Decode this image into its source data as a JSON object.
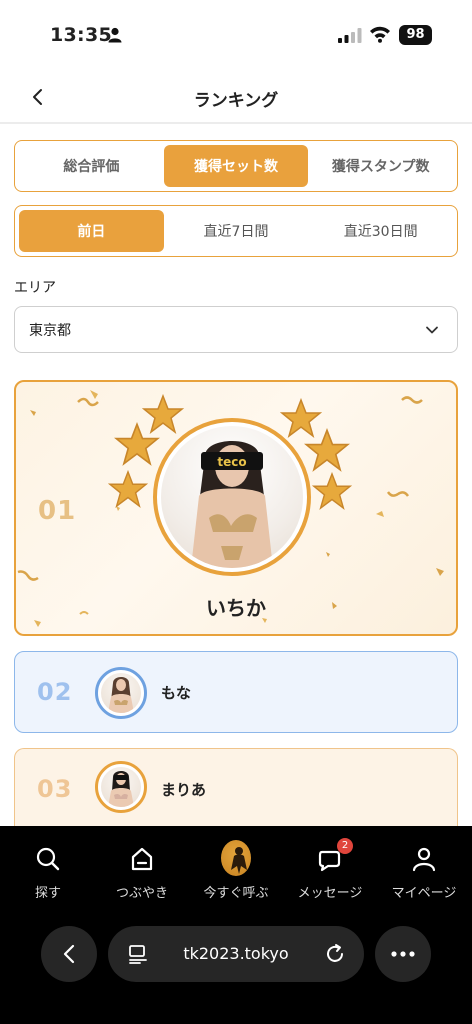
{
  "status_bar": {
    "time": "13:35",
    "battery": "98"
  },
  "header": {
    "title": "ランキング"
  },
  "ranking_type_tabs": [
    {
      "label": "総合評価",
      "active": false
    },
    {
      "label": "獲得セット数",
      "active": true
    },
    {
      "label": "獲得スタンプ数",
      "active": false
    }
  ],
  "period_tabs": [
    {
      "label": "前日",
      "active": true
    },
    {
      "label": "直近7日間",
      "active": false
    },
    {
      "label": "直近30日間",
      "active": false
    }
  ],
  "area": {
    "label": "エリア",
    "selected": "東京都"
  },
  "avatar_badge": "teco",
  "rankings": [
    {
      "rank": "01",
      "name": "いちか"
    },
    {
      "rank": "02",
      "name": "もな"
    },
    {
      "rank": "03",
      "name": "まりあ"
    }
  ],
  "bottom_nav": [
    {
      "label": "探す",
      "icon": "search-icon"
    },
    {
      "label": "つぶやき",
      "icon": "home-icon"
    },
    {
      "label": "今すぐ呼ぶ",
      "icon": "call-now-icon"
    },
    {
      "label": "メッセージ",
      "icon": "message-icon",
      "badge": "2"
    },
    {
      "label": "マイページ",
      "icon": "person-icon"
    }
  ],
  "browser": {
    "url": "tk2023.tokyo"
  },
  "colors": {
    "accent": "#e9a13d",
    "rank2_border": "#8db7ea",
    "badge": "#e0453c"
  }
}
